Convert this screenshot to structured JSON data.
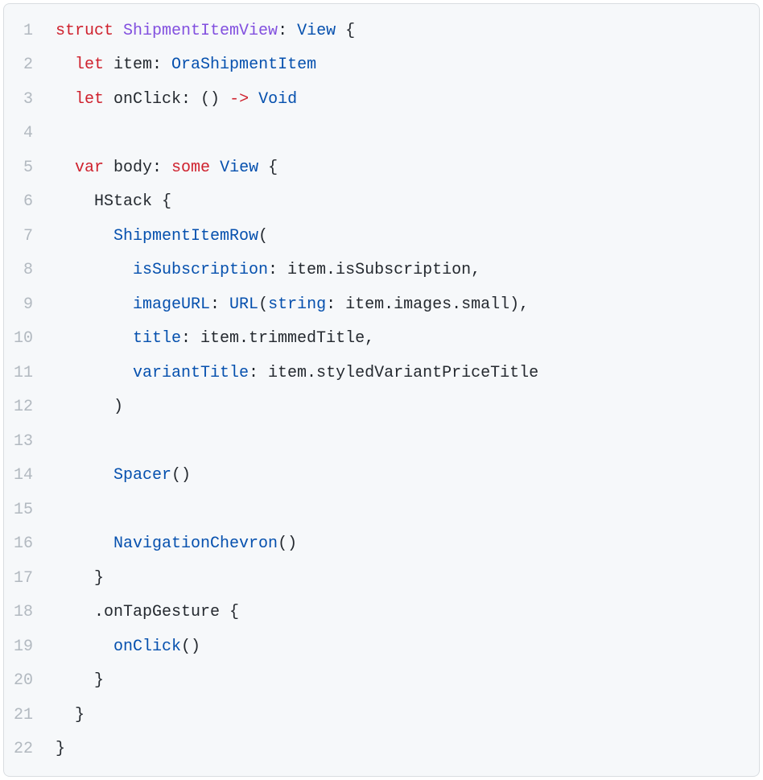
{
  "language": "swift",
  "colors": {
    "keyword": "#cf222e",
    "type": "#8250df",
    "call": "#0550ae",
    "param": "#0550ae",
    "default": "#24292f",
    "gutter": "#b2b9c0",
    "background": "#f6f8fa"
  },
  "lineNumbers": [
    "1",
    "2",
    "3",
    "4",
    "5",
    "6",
    "7",
    "8",
    "9",
    "10",
    "11",
    "12",
    "13",
    "14",
    "15",
    "16",
    "17",
    "18",
    "19",
    "20",
    "21",
    "22"
  ],
  "tokens": {
    "l1": {
      "t1": "struct",
      "t2": " ",
      "t3": "ShipmentItemView",
      "t4": ": ",
      "t5": "View",
      "t6": " {"
    },
    "l2": {
      "t1": "  ",
      "t2": "let",
      "t3": " item: ",
      "t4": "OraShipmentItem"
    },
    "l3": {
      "t1": "  ",
      "t2": "let",
      "t3": " onClick: () ",
      "t4": "->",
      "t5": " ",
      "t6": "Void"
    },
    "l4": {
      "t1": ""
    },
    "l5": {
      "t1": "  ",
      "t2": "var",
      "t3": " body: ",
      "t4": "some",
      "t5": " ",
      "t6": "View",
      "t7": " {"
    },
    "l6": {
      "t1": "    HStack {"
    },
    "l7": {
      "t1": "      ",
      "t2": "ShipmentItemRow",
      "t3": "("
    },
    "l8": {
      "t1": "        ",
      "t2": "isSubscription",
      "t3": ": item.isSubscription,"
    },
    "l9": {
      "t1": "        ",
      "t2": "imageURL",
      "t3": ": ",
      "t4": "URL",
      "t5": "(",
      "t6": "string",
      "t7": ": item.images.small),"
    },
    "l10": {
      "t1": "        ",
      "t2": "title",
      "t3": ": item.trimmedTitle,"
    },
    "l11": {
      "t1": "        ",
      "t2": "variantTitle",
      "t3": ": item.styledVariantPriceTitle"
    },
    "l12": {
      "t1": "      )"
    },
    "l13": {
      "t1": ""
    },
    "l14": {
      "t1": "      ",
      "t2": "Spacer",
      "t3": "()"
    },
    "l15": {
      "t1": ""
    },
    "l16": {
      "t1": "      ",
      "t2": "NavigationChevron",
      "t3": "()"
    },
    "l17": {
      "t1": "    }"
    },
    "l18": {
      "t1": "    .onTapGesture {"
    },
    "l19": {
      "t1": "      ",
      "t2": "onClick",
      "t3": "()"
    },
    "l20": {
      "t1": "    }"
    },
    "l21": {
      "t1": "  }"
    },
    "l22": {
      "t1": "}"
    }
  }
}
